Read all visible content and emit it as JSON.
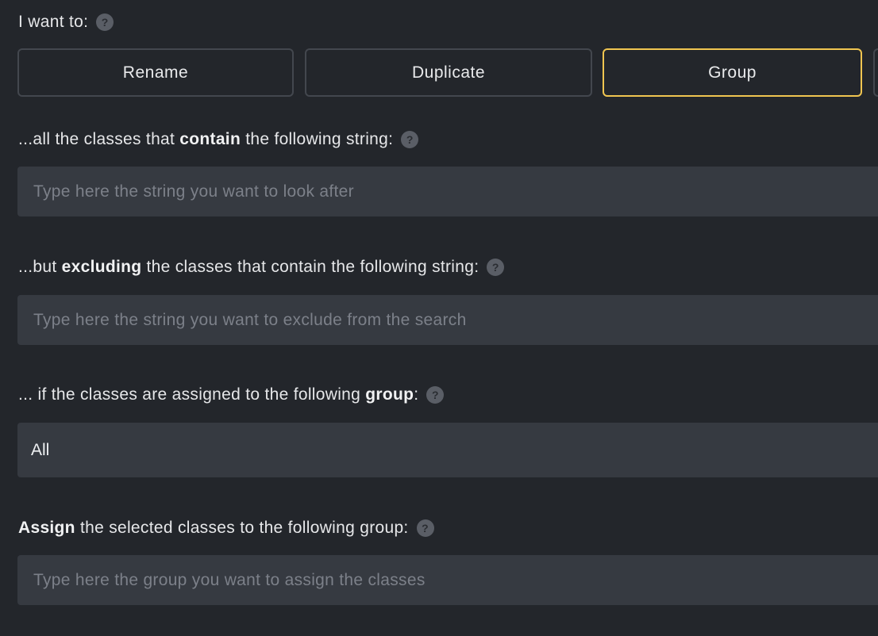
{
  "mode": {
    "label": "I want to:",
    "options": [
      "Rename",
      "Duplicate",
      "Group"
    ],
    "selected": "Group"
  },
  "contain": {
    "label_pre": "...all the classes that ",
    "label_bold": "contain",
    "label_post": " the following string:",
    "placeholder": "Type here the string you want to look after",
    "value": ""
  },
  "exclude": {
    "label_pre": "...but ",
    "label_bold": "excluding",
    "label_post": " the classes that contain the following string:",
    "placeholder": "Type here the string you want to exclude from the search",
    "value": ""
  },
  "group_filter": {
    "label_pre": "... if the classes are assigned to the following ",
    "label_bold": "group",
    "label_post": ":",
    "selected": "All"
  },
  "assign": {
    "label_bold": "Assign",
    "label_post": " the selected classes to the following group:",
    "placeholder": "Type here the group you want to assign the classes",
    "value": ""
  },
  "help_icon_glyph": "?",
  "colors": {
    "background": "#23262b",
    "field": "#363a41",
    "active_border": "#f0c550",
    "button_border": "#43474e"
  }
}
